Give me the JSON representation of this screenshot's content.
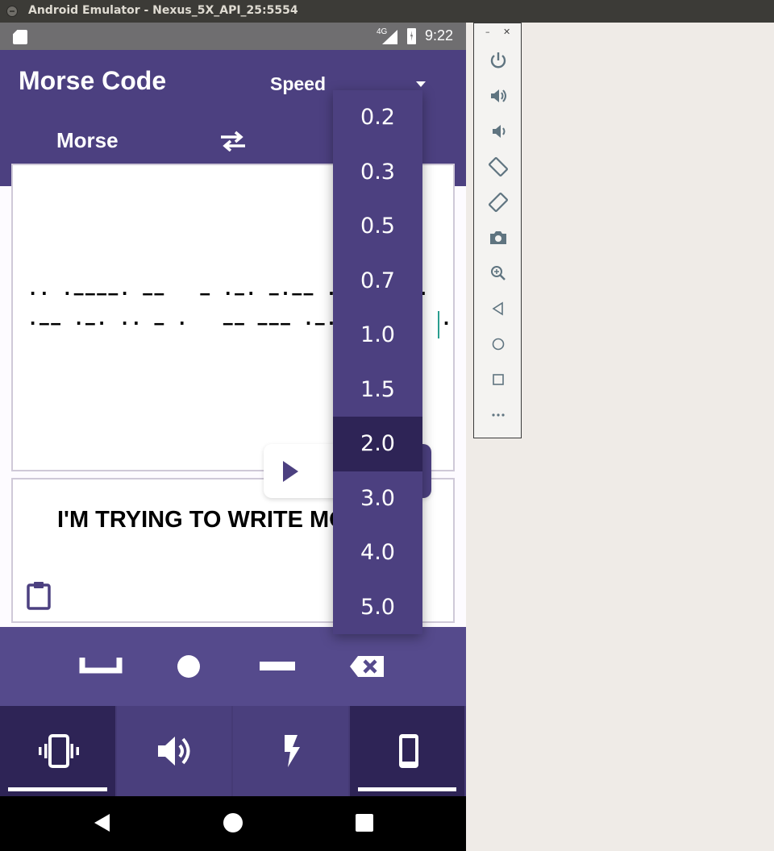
{
  "window": {
    "title": "Android Emulator - Nexus_5X_API_25:5554"
  },
  "status_bar": {
    "network": "4G",
    "time": "9:22"
  },
  "app_bar": {
    "title": "Morse Code",
    "speed_label": "Speed",
    "mode_label": "Morse"
  },
  "morse_input": {
    "line1": "·· ·−−−−· −−   − ·−· −·−− ·· −· −−·",
    "line2": "·−− ·−· ·· − ·   −− −−− ·−· ··· ·   · ··"
  },
  "text_output": {
    "value": "I'M TRYING TO WRITE MORSE"
  },
  "speed_dropdown": {
    "options": [
      "0.2",
      "0.3",
      "0.5",
      "0.7",
      "1.0",
      "1.5",
      "2.0",
      "3.0",
      "4.0",
      "5.0"
    ],
    "selected": "2.0"
  },
  "keyboard": {
    "keys": [
      "space-key",
      "dot-key",
      "dash-key",
      "backspace-key"
    ]
  },
  "output_modes": {
    "tabs": [
      {
        "name": "vibrate",
        "active": true
      },
      {
        "name": "sound",
        "active": false
      },
      {
        "name": "flash",
        "active": false
      },
      {
        "name": "screen",
        "active": true
      }
    ]
  },
  "emulator_controls": [
    "power",
    "volume-up",
    "volume-down",
    "rotate-left",
    "rotate-right",
    "screenshot",
    "zoom",
    "back",
    "home",
    "overview",
    "more"
  ],
  "colors": {
    "primary": "#4c4080",
    "primary_dark": "#2e2456",
    "accent": "#2a9d8f"
  }
}
